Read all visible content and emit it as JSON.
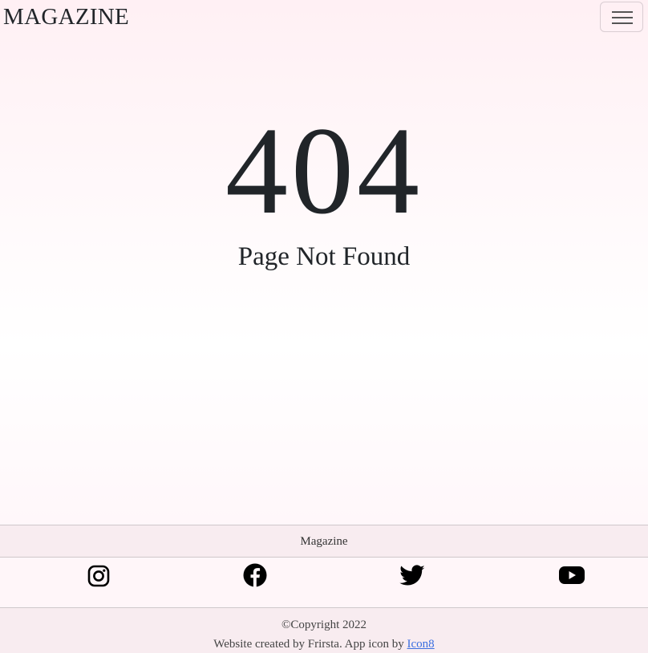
{
  "navbar": {
    "brand": "MAGAZINE",
    "toggler_icon": "hamburger-menu-icon"
  },
  "main": {
    "error_code": "404",
    "error_message": "Page Not Found"
  },
  "footer": {
    "title": "Magazine",
    "social": [
      {
        "name": "instagram-icon"
      },
      {
        "name": "facebook-icon"
      },
      {
        "name": "twitter-icon"
      },
      {
        "name": "youtube-icon"
      }
    ],
    "copyright": "©Copyright 2022",
    "credit_text": "Website created by Frirsta. App icon by ",
    "credit_link": "Icon8"
  },
  "colors": {
    "text": "#212529",
    "footer_bg": "#f8ecf0",
    "page_bg_top": "#fff0f4",
    "link": "#3b6fe0"
  }
}
